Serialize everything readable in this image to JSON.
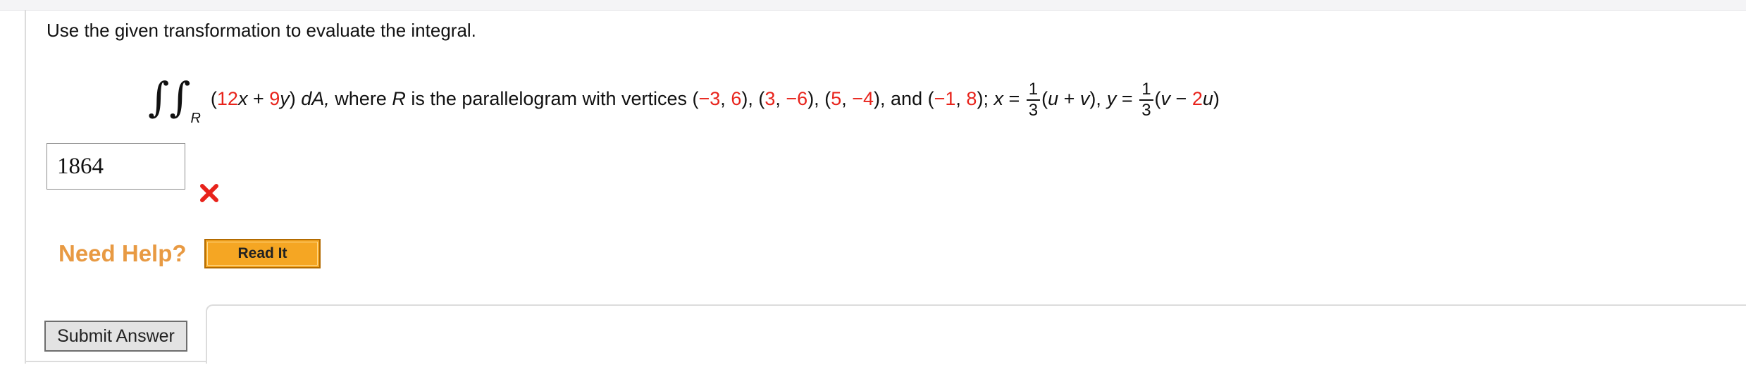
{
  "question": {
    "prompt": "Use the given transformation to evaluate the integral.",
    "integral_symbol": "∫∫",
    "region_subscript": "R",
    "integrand": {
      "open": "(",
      "coef_x": "12",
      "var_x": "x",
      "plus": " + ",
      "coef_y": "9",
      "var_y": "y",
      "close": ")",
      "differential": " dA,"
    },
    "where_text": " where ",
    "region_var": "R",
    "is_text": " is the parallelogram with vertices ",
    "vertices": [
      {
        "x": "−3",
        "y": "6"
      },
      {
        "x": "3",
        "y": "−6"
      },
      {
        "x": "5",
        "y": "−4"
      },
      {
        "x": "−1",
        "y": "8"
      }
    ],
    "and_text": "and ",
    "semicolon": "; ",
    "transform_x": {
      "lhs": "x",
      "equals": " = ",
      "numerator": "1",
      "denominator": "3",
      "expr_open": "(",
      "u": "u",
      "plus": " + ",
      "v": "v",
      "expr_close": "),"
    },
    "transform_y": {
      "lhs": "y",
      "equals": " = ",
      "numerator": "1",
      "denominator": "3",
      "expr_open": "(",
      "v": "v",
      "minus": " − ",
      "coef": "2",
      "u": "u",
      "expr_close": ")"
    }
  },
  "answer": {
    "value": "1864",
    "status_icon": "x-mark-icon",
    "status_color": "#e8231b"
  },
  "help": {
    "label": "Need Help?",
    "read_it_label": "Read It"
  },
  "submit": {
    "label": "Submit Answer"
  },
  "colors": {
    "highlight": "#e8231b",
    "need_help": "#e89a43",
    "read_it_bg": "#f5a623"
  }
}
